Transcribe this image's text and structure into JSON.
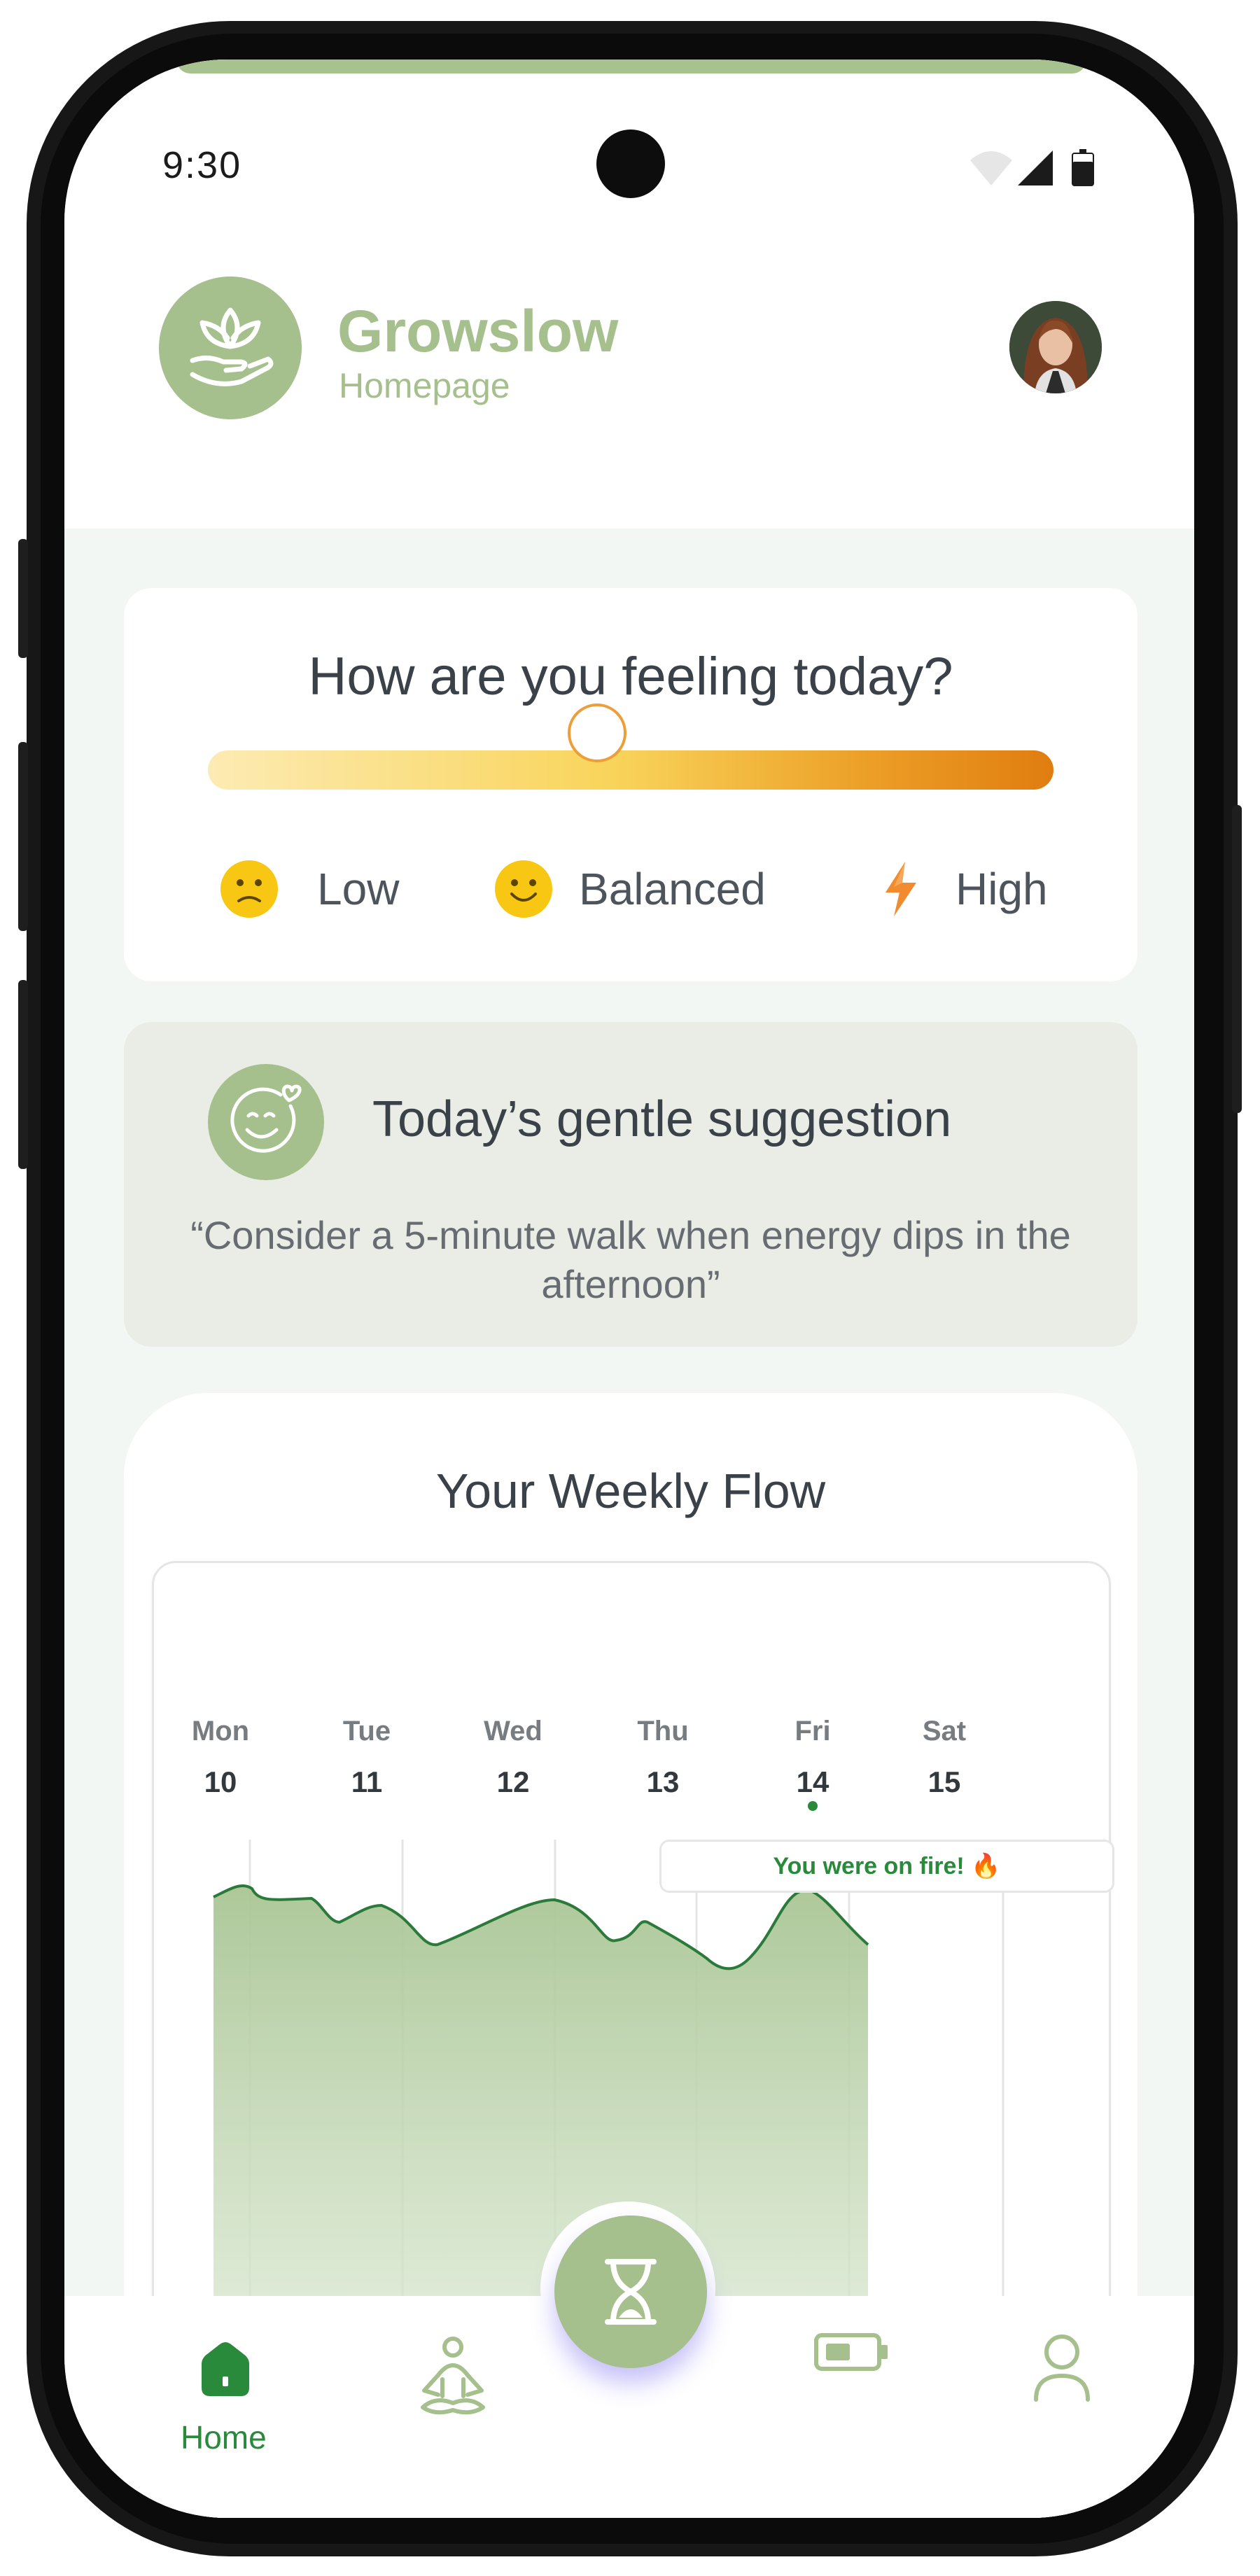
{
  "status_bar": {
    "time": "9:30"
  },
  "header": {
    "app_name": "Growslow",
    "subtitle": "Homepage"
  },
  "mood": {
    "title": "How are you feeling today?",
    "level": 0.46,
    "options": [
      "Low",
      "Balanced",
      "High"
    ]
  },
  "suggestion": {
    "title": "Today’s gentle suggestion",
    "quote": "“Consider a 5-minute walk when energy dips in the afternoon”"
  },
  "weekly": {
    "title": "Your Weekly Flow",
    "days": [
      {
        "name": "Mon",
        "num": "10"
      },
      {
        "name": "Tue",
        "num": "11"
      },
      {
        "name": "Wed",
        "num": "12"
      },
      {
        "name": "Thu",
        "num": "13"
      },
      {
        "name": "Fri",
        "num": "14"
      },
      {
        "name": "Sat",
        "num": "15"
      }
    ],
    "annotation": "You were on fire! 🔥",
    "today_index": 4
  },
  "nav": {
    "items": [
      {
        "label": "Home",
        "icon": "home-icon",
        "active": true
      },
      {
        "label": "",
        "icon": "meditation-icon",
        "active": false
      },
      {
        "label": "",
        "icon": "hourglass-icon",
        "active": false
      },
      {
        "label": "",
        "icon": "battery-icon",
        "active": false
      },
      {
        "label": "",
        "icon": "profile-icon",
        "active": false
      }
    ]
  },
  "colors": {
    "brand_green": "#a5bf8d",
    "active_green": "#2a8a3c",
    "mood_high": "#e07d10",
    "mood_low": "#fcebb3"
  }
}
